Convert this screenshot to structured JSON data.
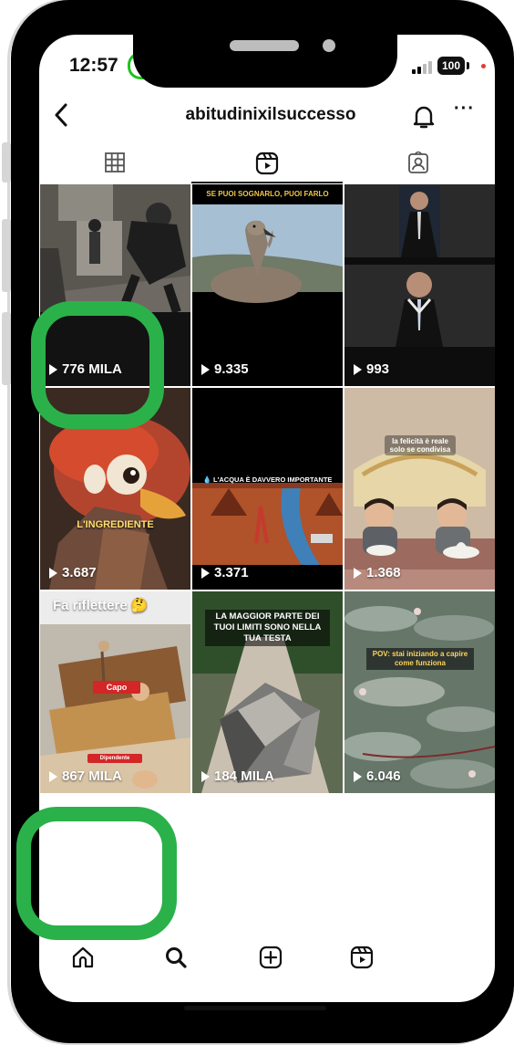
{
  "status_bar": {
    "time": "12:57",
    "battery": "100"
  },
  "header": {
    "username": "abitudinixilsuccesso",
    "back_icon": "back-chevron-icon",
    "bell_icon": "bell-icon",
    "more_icon": "more-dots-icon",
    "more_label": "···"
  },
  "tabs": [
    {
      "name": "grid-tab",
      "icon": "grid-icon",
      "selected": false
    },
    {
      "name": "reels-tab",
      "icon": "reels-icon",
      "selected": true
    },
    {
      "name": "tagged-tab",
      "icon": "tagged-person-icon",
      "selected": false
    }
  ],
  "reels": [
    {
      "views": "776 MILA",
      "caption": ""
    },
    {
      "views": "9.335",
      "caption": "SE PUOI SOGNARLO, PUOI FARLO"
    },
    {
      "views": "993",
      "caption": ""
    },
    {
      "views": "3.687",
      "caption": "L'INGREDIENTE"
    },
    {
      "views": "3.371",
      "caption": "💧 L'ACQUA È DAVVERO IMPORTANTE"
    },
    {
      "views": "1.368",
      "caption": "la felicità è reale solo se condivisa"
    },
    {
      "views": "867 MILA",
      "caption": "Fa riflettere 🤔"
    },
    {
      "views": "184 MILA",
      "caption": "LA MAGGIOR PARTE DEI TUOI LIMITI SONO NELLA TUA TESTA"
    },
    {
      "views": "6.046",
      "caption": "POV: stai iniziando a capire come funziona"
    }
  ],
  "inner_labels": {
    "capo": "Capo",
    "dipendente": "Dipendente"
  },
  "bottom_nav": [
    {
      "name": "nav-home",
      "icon": "home-icon"
    },
    {
      "name": "nav-search",
      "icon": "search-icon"
    },
    {
      "name": "nav-create",
      "icon": "add-square-icon"
    },
    {
      "name": "nav-reels",
      "icon": "reels-icon"
    }
  ],
  "colors": {
    "highlight": "#2bb14a",
    "text": "#111111",
    "background": "#ffffff"
  }
}
